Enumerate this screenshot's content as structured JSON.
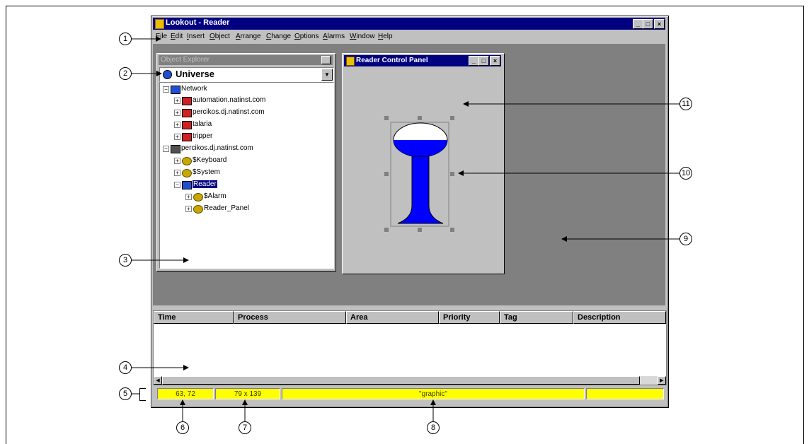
{
  "window": {
    "title": "Lookout - Reader",
    "controls": [
      "_",
      "□",
      "×"
    ]
  },
  "menu": [
    "File",
    "Edit",
    "Insert",
    "Object",
    "Arrange",
    "Change",
    "Options",
    "Alarms",
    "Window",
    "Help"
  ],
  "object_explorer": {
    "title": "Object Explorer",
    "close": "×",
    "combo_value": "Universe",
    "combo_arrow": "▼",
    "tree": [
      {
        "label": "Network",
        "expander": "−",
        "icon": "network-icon"
      },
      {
        "label": "automation.natinst.com",
        "expander": "+",
        "icon": "computer-icon"
      },
      {
        "label": "percikos.dj.natinst.com",
        "expander": "+",
        "icon": "computer-icon"
      },
      {
        "label": "talaria",
        "expander": "+",
        "icon": "computer-icon"
      },
      {
        "label": "tripper",
        "expander": "+",
        "icon": "computer-icon"
      },
      {
        "label": "percikos.dj.natinst.com",
        "expander": "−",
        "icon": "local-computer-icon"
      },
      {
        "label": "$Keyboard",
        "expander": "+",
        "icon": "gear-icon"
      },
      {
        "label": "$System",
        "expander": "+",
        "icon": "gear-icon"
      },
      {
        "label": "Reader",
        "expander": "−",
        "icon": "process-icon"
      },
      {
        "label": "$Alarm",
        "expander": "+",
        "icon": "gear-icon"
      },
      {
        "label": "Reader_Panel",
        "expander": "+",
        "icon": "gear-icon"
      }
    ]
  },
  "control_panel": {
    "title": "Reader Control Panel",
    "tank_fill_level": 0.5,
    "colors": {
      "fill": "#0000ff",
      "empty": "#ffffff"
    }
  },
  "alarm_columns": [
    "Time",
    "Process",
    "Area",
    "Priority",
    "Tag",
    "Description"
  ],
  "scroll": {
    "left": "◀",
    "right": "▶"
  },
  "status": {
    "position": "63, 72",
    "size": "79 x 139",
    "selection": "\"graphic\""
  },
  "callouts": [
    "1",
    "2",
    "3",
    "4",
    "5",
    "6",
    "7",
    "8",
    "9",
    "10",
    "11"
  ]
}
